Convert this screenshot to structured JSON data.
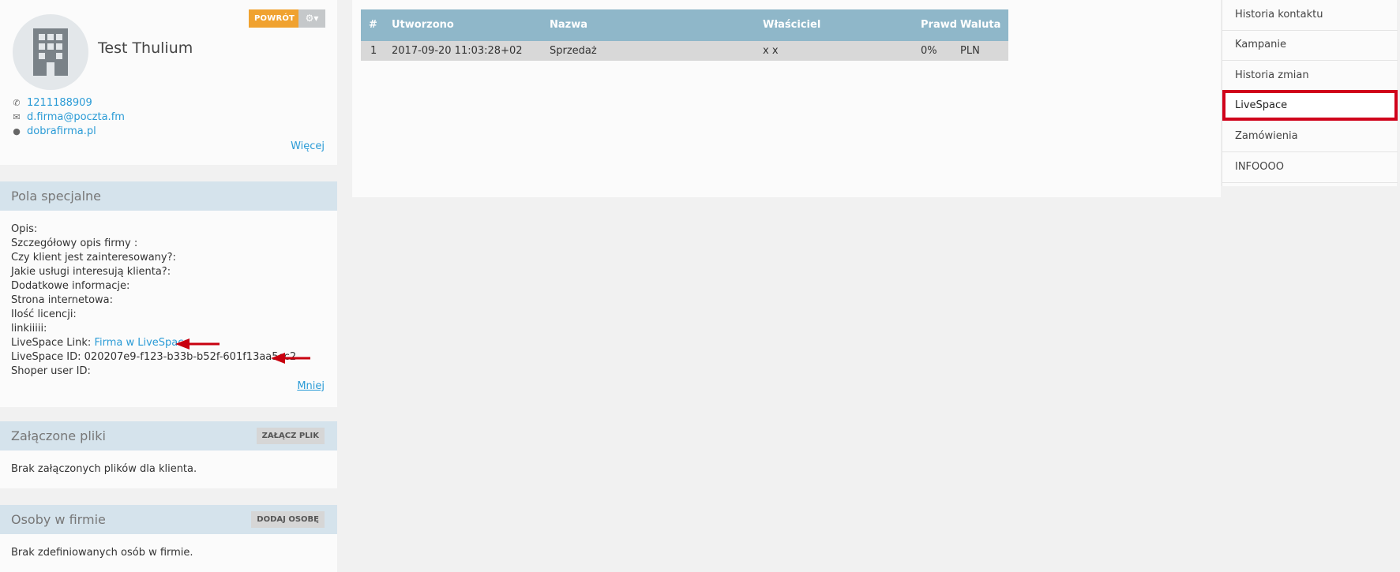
{
  "profile": {
    "name": "Test Thulium",
    "back_label": "POWRÓT",
    "gear_label": "⚙▾",
    "phone": "1211188909",
    "email": "d.firma@poczta.fm",
    "website": "dobrafirma.pl",
    "more_label": "Więcej"
  },
  "special_fields": {
    "title": "Pola specjalne",
    "lines": {
      "opis": "Opis:",
      "szczegolowy": "Szczegółowy opis firmy :",
      "zainteresowany": "Czy klient jest zainteresowany?:",
      "uslugi": "Jakie usługi interesują klienta?:",
      "dodatkowe": "Dodatkowe informacje:",
      "strona": "Strona internetowa:",
      "licencje": "Ilość licencji:",
      "linki": "linkiiiii:",
      "ls_link_label": "LiveSpace Link:",
      "ls_link_text": "Firma w LiveSpace",
      "ls_id": "LiveSpace ID: 020207e9-f123-b33b-b52f-601f13aa5cc2",
      "shoper": "Shoper user ID:"
    },
    "less_label": "Mniej"
  },
  "files": {
    "title": "Załączone pliki",
    "button": "ZAŁĄCZ PLIK",
    "empty": "Brak załączonych plików dla klienta."
  },
  "people": {
    "title": "Osoby w firmie",
    "button": "DODAJ OSOBĘ",
    "empty": "Brak zdefiniowanych osób w firmie."
  },
  "table": {
    "headers": {
      "num": "#",
      "created": "Utworzono",
      "name": "Nazwa",
      "owner": "Właściciel",
      "prob": "Prawd",
      "currency": "Waluta"
    },
    "rows": [
      {
        "num": "1",
        "created": "2017-09-20 11:03:28+02",
        "name": "Sprzedaż",
        "owner": "x x",
        "prob": "0%",
        "currency": "PLN"
      }
    ]
  },
  "nav": {
    "items": [
      "Historia kontaktu",
      "Kampanie",
      "Historia zmian",
      "LiveSpace",
      "Zamówienia",
      "INFOOOO"
    ],
    "active_index": 3
  },
  "colors": {
    "accent": "#2a9bd6",
    "back_button": "#f0a22f",
    "table_header": "#8fb7c9",
    "panel_header": "#d5e3ec",
    "highlight": "#d0021b"
  }
}
